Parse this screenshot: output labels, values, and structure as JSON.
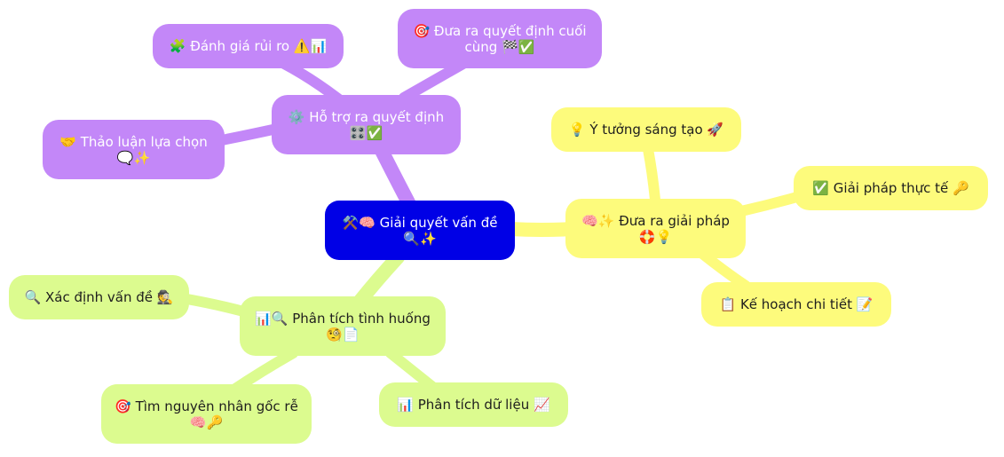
{
  "colors": {
    "root": "#0000e6",
    "purple": "#c387f8",
    "yellow": "#fdfb7c",
    "green": "#dcfb8f"
  },
  "nodes": {
    "root": {
      "text": "⚒️🧠 Giải quyết vấn đề 🔍✨"
    },
    "decision_support": {
      "text": "⚙️ Hỗ trợ ra quyết định 🎛️✅"
    },
    "risk": {
      "text": "🧩 Đánh giá rủi ro ⚠️📊"
    },
    "final": {
      "text": "🎯 Đưa ra quyết định cuối cùng 🏁✅"
    },
    "discuss": {
      "text": "🤝 Thảo luận lựa chọn 🗨️✨"
    },
    "solution": {
      "text": "🧠✨ Đưa ra giải pháp 🛟💡"
    },
    "idea": {
      "text": "💡 Ý tưởng sáng tạo 🚀"
    },
    "practical": {
      "text": "✅ Giải pháp thực tế 🔑"
    },
    "plan": {
      "text": "📋 Kế hoạch chi tiết 📝"
    },
    "analysis": {
      "text": "📊🔍 Phân tích tình huống 🧐📄"
    },
    "identify": {
      "text": "🔍 Xác định vấn đề 🕵️"
    },
    "root_cause": {
      "text": "🎯 Tìm nguyên nhân gốc rễ 🧠🔑"
    },
    "data": {
      "text": "📊 Phân tích dữ liệu 📈"
    }
  }
}
